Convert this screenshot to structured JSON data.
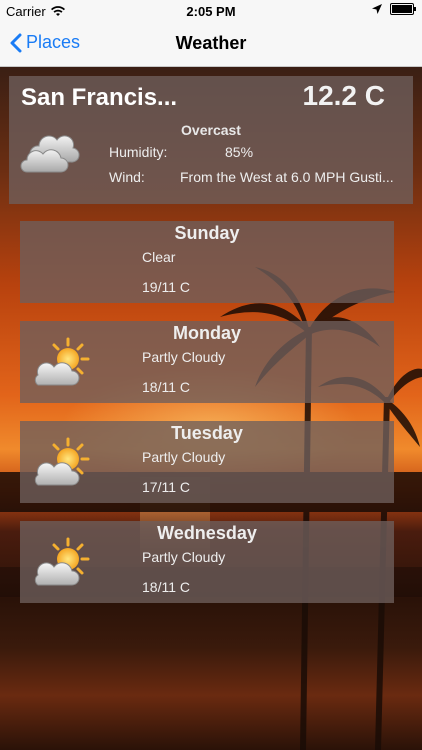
{
  "status_bar": {
    "carrier": "Carrier",
    "time": "2:05 PM"
  },
  "nav": {
    "back_label": "Places",
    "title": "Weather"
  },
  "current": {
    "city": "San Francis...",
    "temperature": "12.2 C",
    "condition": "Overcast",
    "humidity_label": "Humidity:",
    "humidity_value": "85%",
    "wind_label": "Wind:",
    "wind_value": "From the West at 6.0 MPH Gusti..."
  },
  "forecast": [
    {
      "day": "Sunday",
      "condition": "Clear",
      "range": "19/11 C",
      "icon": "none"
    },
    {
      "day": "Monday",
      "condition": "Partly Cloudy",
      "range": "18/11 C",
      "icon": "partly-cloudy-icon"
    },
    {
      "day": "Tuesday",
      "condition": "Partly Cloudy",
      "range": "17/11 C",
      "icon": "partly-cloudy-icon"
    },
    {
      "day": "Wednesday",
      "condition": "Partly Cloudy",
      "range": "18/11 C",
      "icon": "partly-cloudy-icon"
    }
  ],
  "colors": {
    "accent": "#1a7cf5",
    "card": "#6e5f5c"
  }
}
